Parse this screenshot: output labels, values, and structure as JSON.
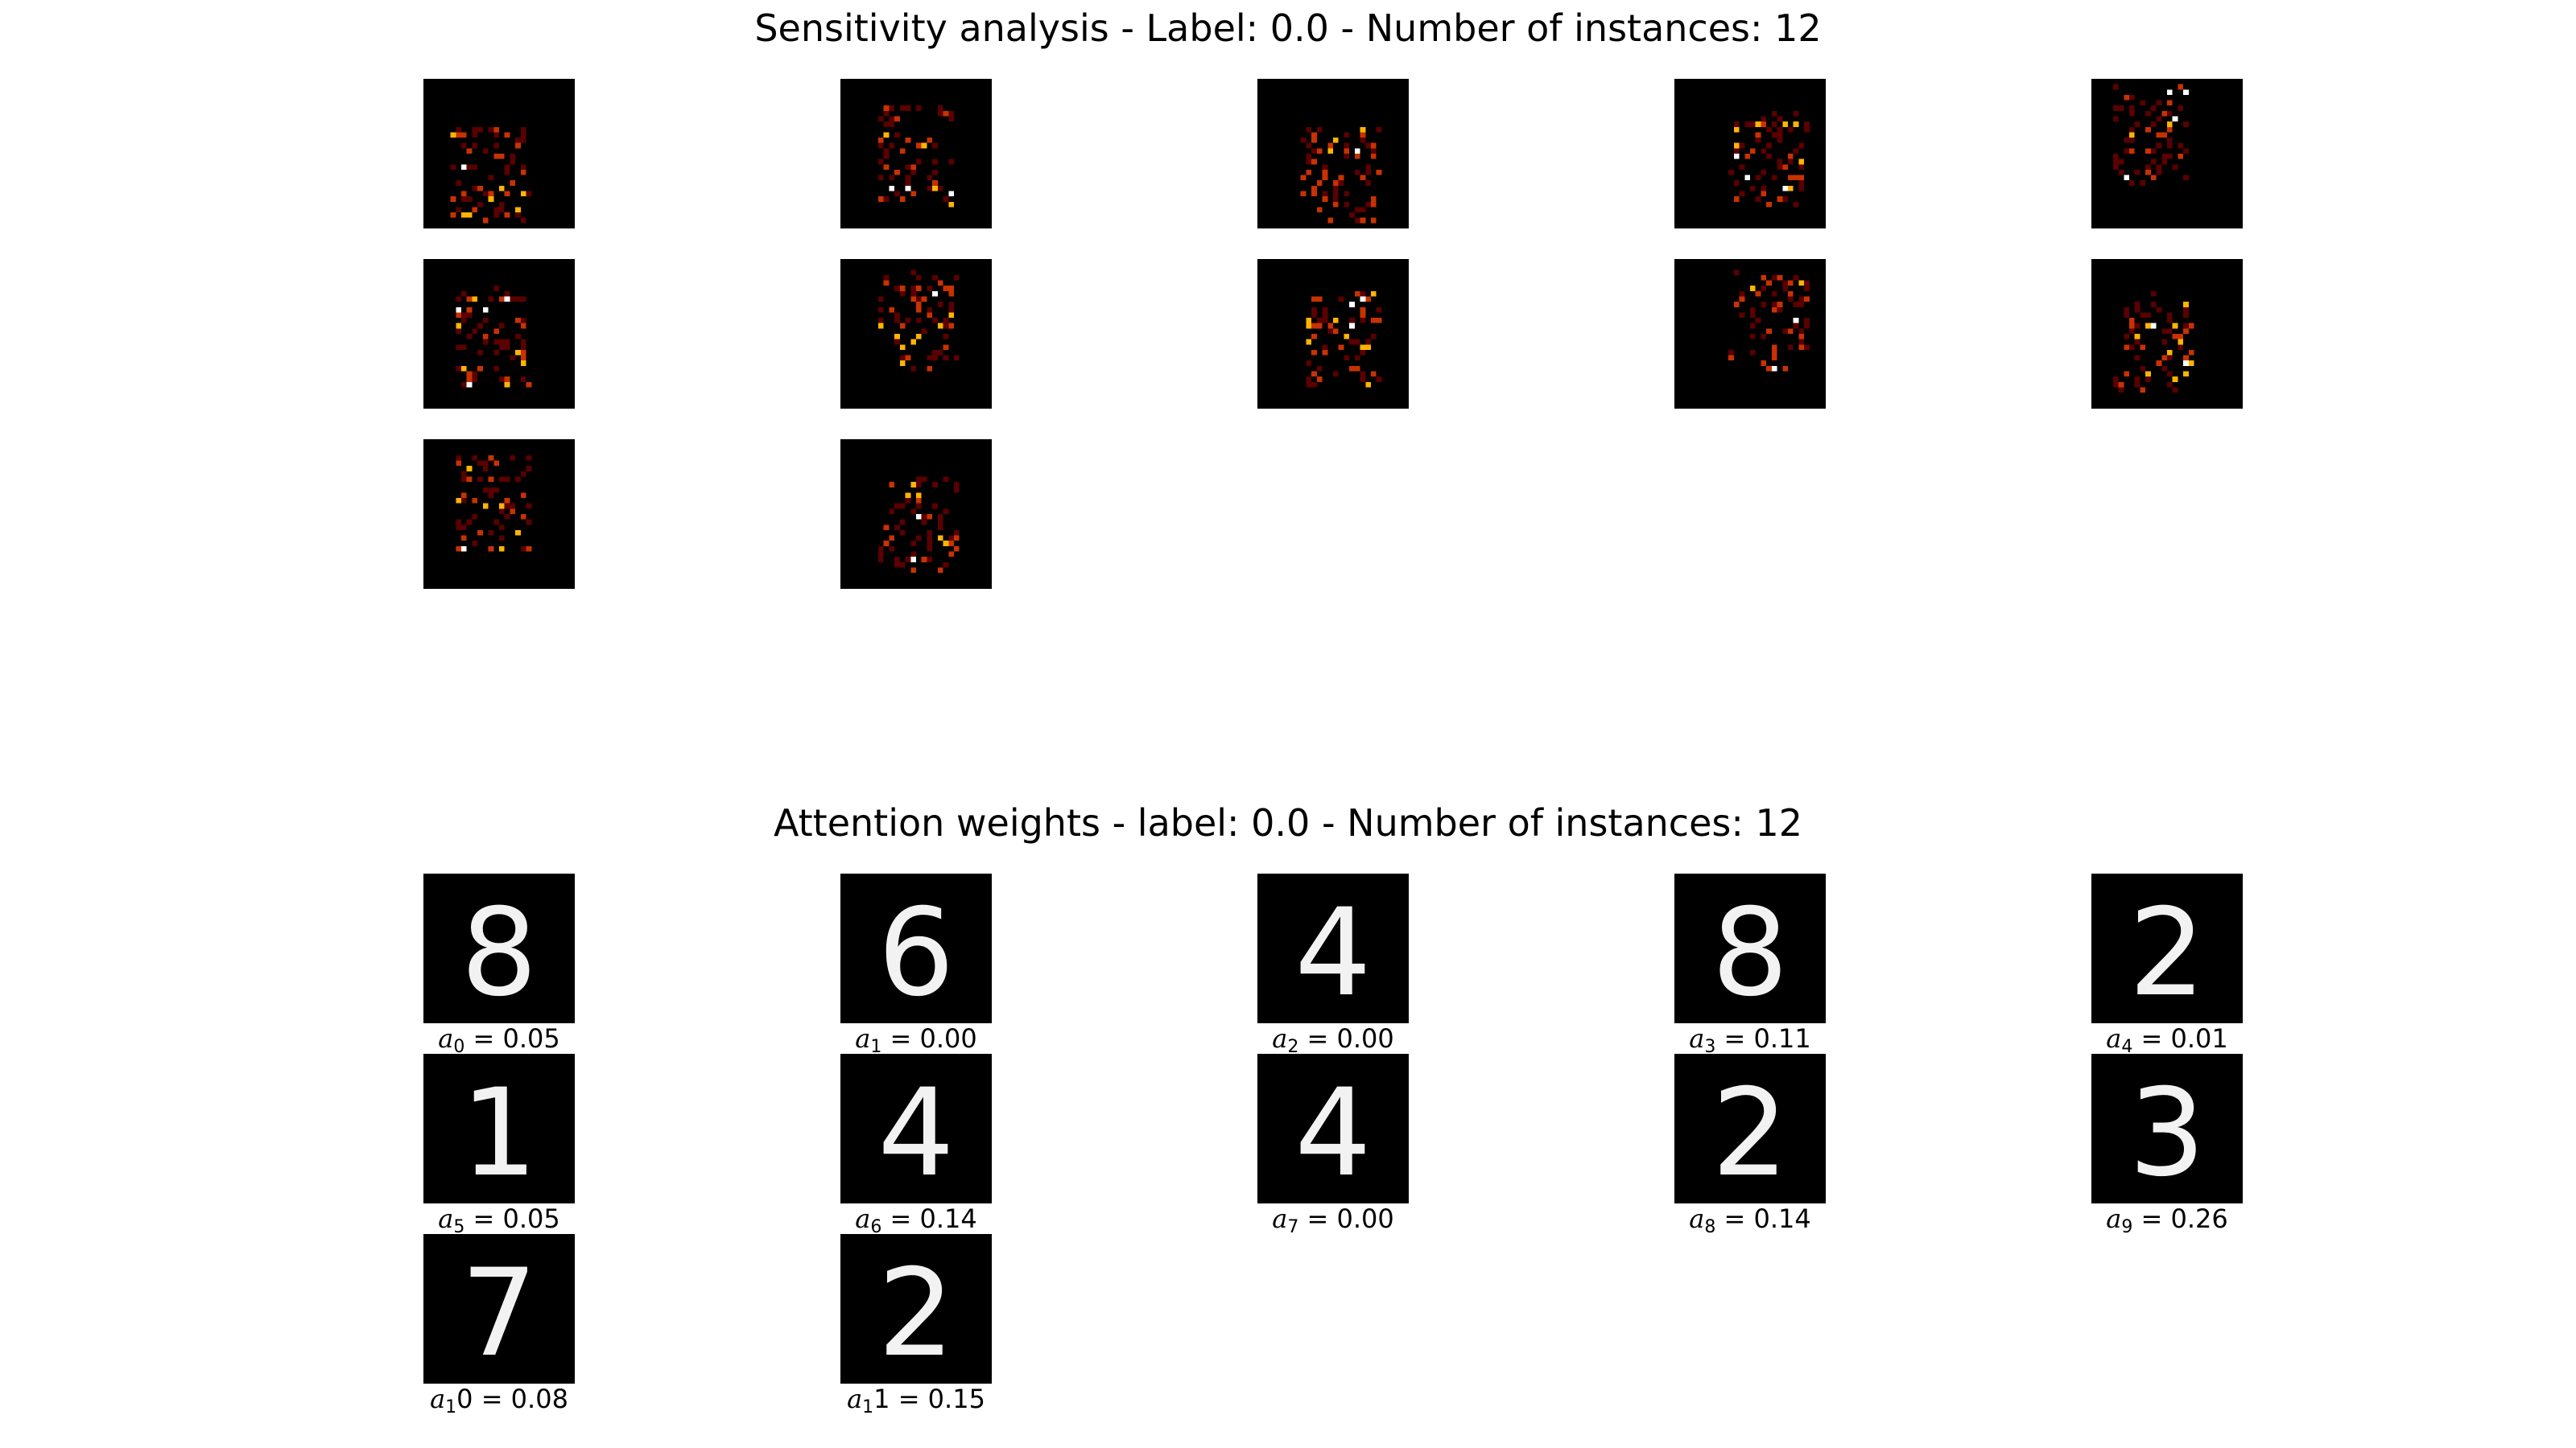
{
  "figure": {
    "top_title": "Sensitivity analysis - Label: 0.0 - Number of instances: 12",
    "bottom_title": "Attention weights - label: 0.0 - Number of instances: 12"
  },
  "sensitivity_maps": [
    {
      "id": 0
    },
    {
      "id": 1
    },
    {
      "id": 2
    },
    {
      "id": 3
    },
    {
      "id": 4
    },
    {
      "id": 5
    },
    {
      "id": 6
    },
    {
      "id": 7
    },
    {
      "id": 8
    },
    {
      "id": 9
    },
    {
      "id": 10
    },
    {
      "id": 11
    }
  ],
  "instances": [
    {
      "digit": "8",
      "symbol": "a",
      "sub": "0",
      "suffix": "",
      "value": "0.05"
    },
    {
      "digit": "6",
      "symbol": "a",
      "sub": "1",
      "suffix": "",
      "value": "0.00"
    },
    {
      "digit": "4",
      "symbol": "a",
      "sub": "2",
      "suffix": "",
      "value": "0.00"
    },
    {
      "digit": "8",
      "symbol": "a",
      "sub": "3",
      "suffix": "",
      "value": "0.11"
    },
    {
      "digit": "2",
      "symbol": "a",
      "sub": "4",
      "suffix": "",
      "value": "0.01"
    },
    {
      "digit": "1",
      "symbol": "a",
      "sub": "5",
      "suffix": "",
      "value": "0.05"
    },
    {
      "digit": "4",
      "symbol": "a",
      "sub": "6",
      "suffix": "",
      "value": "0.14"
    },
    {
      "digit": "4",
      "symbol": "a",
      "sub": "7",
      "suffix": "",
      "value": "0.00"
    },
    {
      "digit": "2",
      "symbol": "a",
      "sub": "8",
      "suffix": "",
      "value": "0.14"
    },
    {
      "digit": "3",
      "symbol": "a",
      "sub": "9",
      "suffix": "",
      "value": "0.26"
    },
    {
      "digit": "7",
      "symbol": "a",
      "sub": "1",
      "suffix": "0",
      "value": "0.08"
    },
    {
      "digit": "2",
      "symbol": "a",
      "sub": "1",
      "suffix": "1",
      "value": "0.15"
    }
  ],
  "colors": {
    "background": "#ffffff",
    "tile": "#000000",
    "heat_low": "#5a0000",
    "heat_mid": "#c83200",
    "heat_high": "#ffb400",
    "heat_peak": "#ffffff",
    "digit": "#f2f2f2"
  }
}
